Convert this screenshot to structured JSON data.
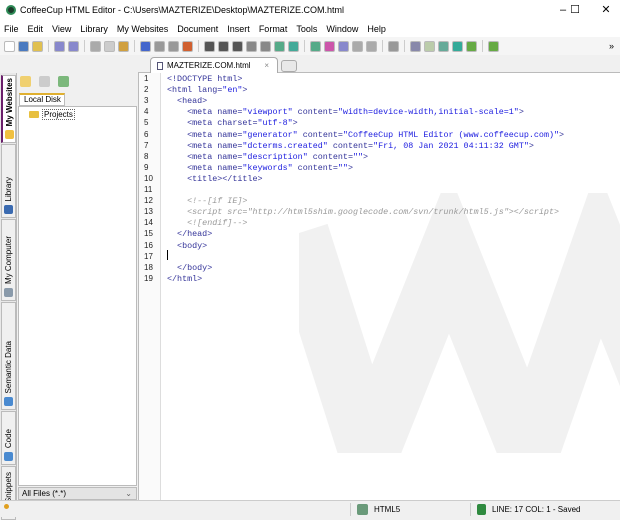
{
  "window": {
    "title": "CoffeeCup HTML Editor - C:\\Users\\MAZTERIZE\\Desktop\\MAZTERIZE.COM.html",
    "minimize": "–",
    "maximize": "☐",
    "close": "✕"
  },
  "menu": [
    "File",
    "Edit",
    "View",
    "Library",
    "My Websites",
    "Document",
    "Insert",
    "Format",
    "Tools",
    "Window",
    "Help"
  ],
  "toolbar_overflow": "»",
  "tabs": {
    "active": "MAZTERIZE.COM.html",
    "close": "×"
  },
  "side_tabs": [
    "My Websites",
    "Library",
    "My Computer",
    "Semantic Data",
    "Code",
    "Snippets"
  ],
  "panel": {
    "tab": "Local Disk",
    "tree": [
      "Projects"
    ],
    "filter": "All Files (*.*)"
  },
  "editor": {
    "lines": [
      [
        [
          "<!DOCTYPE html>",
          ""
        ]
      ],
      [
        [
          "<html lang=",
          ""
        ],
        [
          "\"en\"",
          "s"
        ],
        [
          ">",
          ""
        ]
      ],
      [
        [
          "  <head>",
          ""
        ]
      ],
      [
        [
          "    <meta name=",
          ""
        ],
        [
          "\"viewport\"",
          "s"
        ],
        [
          " content=",
          ""
        ],
        [
          "\"width=device-width,initial-scale=1\"",
          "s"
        ],
        [
          ">",
          ""
        ]
      ],
      [
        [
          "    <meta charset=",
          ""
        ],
        [
          "\"utf-8\"",
          "s"
        ],
        [
          ">",
          ""
        ]
      ],
      [
        [
          "    <meta name=",
          ""
        ],
        [
          "\"generator\"",
          "s"
        ],
        [
          " content=",
          ""
        ],
        [
          "\"CoffeeCup HTML Editor (www.coffeecup.com)\"",
          "s"
        ],
        [
          ">",
          ""
        ]
      ],
      [
        [
          "    <meta name=",
          ""
        ],
        [
          "\"dcterms.created\"",
          "s"
        ],
        [
          " content=",
          ""
        ],
        [
          "\"Fri, 08 Jan 2021 04:11:32 GMT\"",
          "s"
        ],
        [
          ">",
          ""
        ]
      ],
      [
        [
          "    <meta name=",
          ""
        ],
        [
          "\"description\"",
          "s"
        ],
        [
          " content=",
          ""
        ],
        [
          "\"\"",
          "s"
        ],
        [
          ">",
          ""
        ]
      ],
      [
        [
          "    <meta name=",
          ""
        ],
        [
          "\"keywords\"",
          "s"
        ],
        [
          " content=",
          ""
        ],
        [
          "\"\"",
          "s"
        ],
        [
          ">",
          ""
        ]
      ],
      [
        [
          "    <title></title>",
          ""
        ]
      ],
      [
        [
          "",
          ""
        ]
      ],
      [
        [
          "    <!--[if IE]>",
          "c"
        ]
      ],
      [
        [
          "    <script src=\"http://html5shim.googlecode.com/svn/trunk/html5.js\"></script>",
          "c"
        ]
      ],
      [
        [
          "    <![endif]-->",
          "c"
        ]
      ],
      [
        [
          "  </head>",
          ""
        ]
      ],
      [
        [
          "  <body>",
          ""
        ]
      ],
      [
        [
          "",
          ""
        ]
      ],
      [
        [
          "  </body>",
          ""
        ]
      ],
      [
        [
          "</html>",
          ""
        ]
      ]
    ]
  },
  "status": {
    "doctype": "HTML5",
    "position": "LINE: 17 COL: 1 - Saved"
  }
}
